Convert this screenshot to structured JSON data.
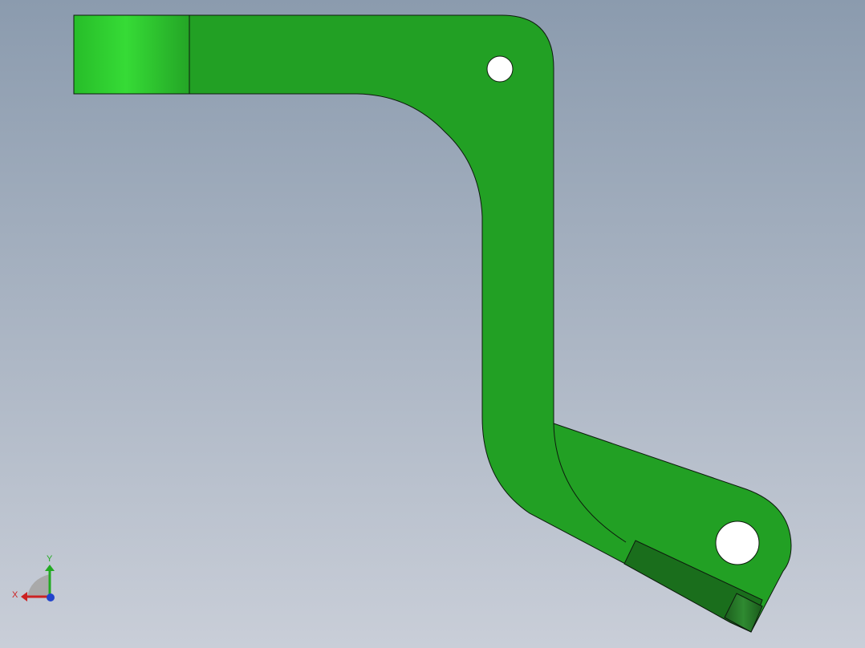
{
  "viewport": {
    "background_top_color": "#8b9bae",
    "background_bottom_color": "#c9ced8"
  },
  "model": {
    "part_color": "#22a024",
    "edge_color": "#0d1a0d",
    "highlight_face_color": "#33d633",
    "shadow_face_color": "#1a6e1c",
    "hole_color": "#ffffff"
  },
  "triad": {
    "x_label": "X",
    "y_label": "Y",
    "x_color": "#cc2222",
    "y_color": "#22aa22",
    "z_color": "#2244cc"
  }
}
